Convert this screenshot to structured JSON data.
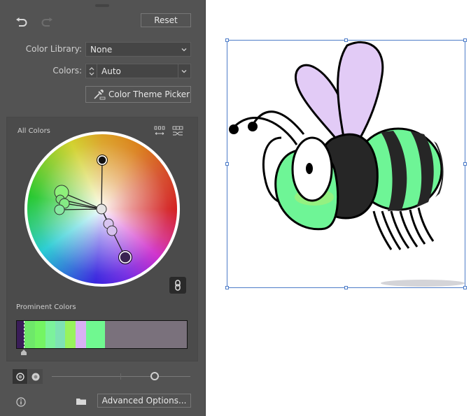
{
  "toolbar": {
    "undo_icon": "undo-icon",
    "redo_icon": "redo-icon",
    "reset_label": "Reset"
  },
  "color_library": {
    "label": "Color Library:",
    "value": "None"
  },
  "colors": {
    "label": "Colors:",
    "value": "Auto"
  },
  "color_theme_picker": {
    "label": "Color Theme Picker",
    "icon": "eyedropper-icon"
  },
  "all_colors": {
    "title": "All Colors",
    "icons": [
      "spread-colors-icon",
      "randomize-order-icon"
    ],
    "link_icon": "link-harmony-icon",
    "wheel_points": [
      {
        "name": "black",
        "color": "#111111"
      },
      {
        "name": "center",
        "color": "#e4e4e4"
      },
      {
        "name": "green-large",
        "color": "#8ef07a"
      },
      {
        "name": "green-1",
        "color": "#7de07a"
      },
      {
        "name": "green-2",
        "color": "#84ea84"
      },
      {
        "name": "mint",
        "color": "#86e8a0"
      },
      {
        "name": "lavender-1",
        "color": "#d8c4f0"
      },
      {
        "name": "lavender-2",
        "color": "#d6c0ee"
      },
      {
        "name": "dark-purple",
        "color": "#3a2352"
      }
    ]
  },
  "prominent_colors": {
    "title": "Prominent Colors",
    "segments": [
      {
        "color": "#3a1d58",
        "weight": 11
      },
      {
        "color": "#6ee86a",
        "weight": 15
      },
      {
        "color": "#74f563",
        "weight": 15
      },
      {
        "color": "#7cf29c",
        "weight": 14
      },
      {
        "color": "#7ee2b4",
        "weight": 14
      },
      {
        "color": "#98f35c",
        "weight": 15
      },
      {
        "color": "#d8b0f4",
        "weight": 15
      },
      {
        "color": "#70f890",
        "weight": 28
      },
      {
        "color": "#7a717c",
        "weight": 117
      }
    ]
  },
  "bottom": {
    "mode_icons": [
      "show-saturation-icon",
      "show-brightness-icon"
    ],
    "slider_value": 0.74,
    "info_icon": "info-icon",
    "folder_icon": "folder-icon",
    "advanced_label": "Advanced Options..."
  },
  "artwork": {
    "name": "bee-illustration",
    "colors": {
      "body_green": "#6ef596",
      "stripe_dark": "#262626",
      "wing": "#e2cbf6",
      "outline": "#000000",
      "cheek": "#9ef07c",
      "shadow": "#d4d4d8"
    }
  }
}
